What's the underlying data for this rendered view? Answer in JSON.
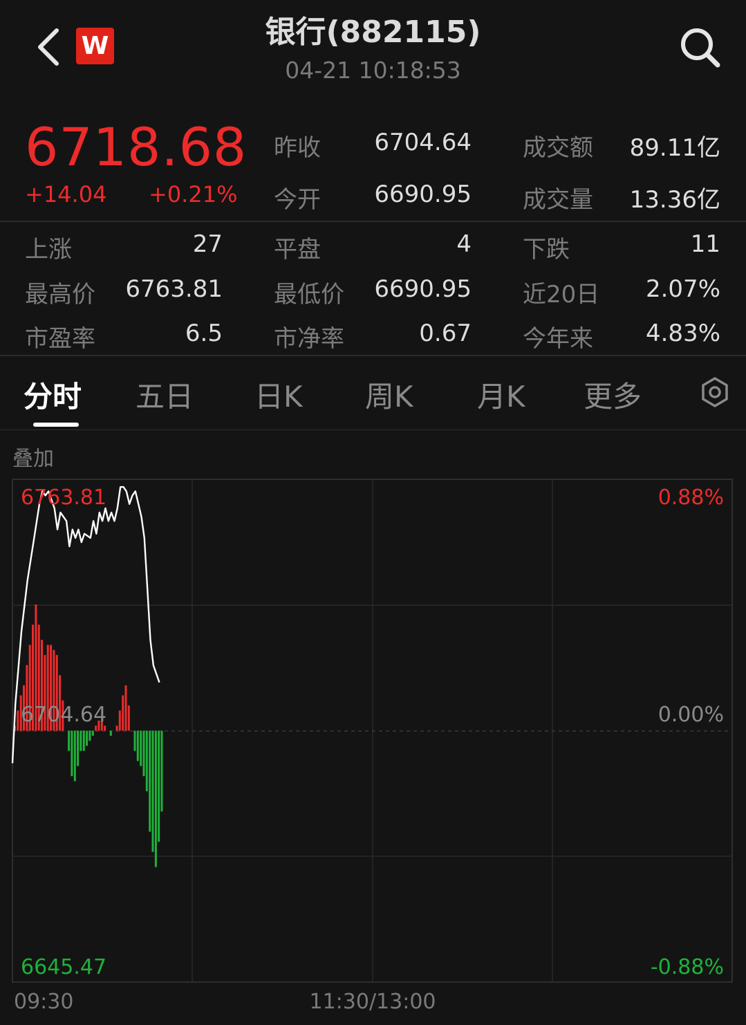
{
  "header": {
    "title": "银行(882115)",
    "timestamp": "04-21 10:18:53",
    "logo_text": "W",
    "icons": {
      "back": "chevron-left-icon",
      "search": "search-icon",
      "settings": "gear-icon"
    }
  },
  "quote": {
    "price": "6718.68",
    "change": "+14.04",
    "change_pct": "+0.21%",
    "stats": [
      {
        "label": "昨收",
        "value": "6704.64"
      },
      {
        "label": "成交额",
        "value": "89.11亿"
      },
      {
        "label": "今开",
        "value": "6690.95"
      },
      {
        "label": "成交量",
        "value": "13.36亿"
      }
    ]
  },
  "details": [
    {
      "label": "上涨",
      "value": "27"
    },
    {
      "label": "平盘",
      "value": "4"
    },
    {
      "label": "下跌",
      "value": "11"
    },
    {
      "label": "最高价",
      "value": "6763.81"
    },
    {
      "label": "最低价",
      "value": "6690.95"
    },
    {
      "label": "近20日",
      "value": "2.07%"
    },
    {
      "label": "市盈率",
      "value": "6.5"
    },
    {
      "label": "市净率",
      "value": "0.67"
    },
    {
      "label": "今年来",
      "value": "4.83%"
    }
  ],
  "tabs": [
    {
      "label": "分时",
      "active": true
    },
    {
      "label": "五日"
    },
    {
      "label": "日K"
    },
    {
      "label": "周K"
    },
    {
      "label": "月K"
    },
    {
      "label": "更多"
    }
  ],
  "overlay_label": "叠加",
  "colors": {
    "up": "#ee2b2b",
    "down": "#1fb23a",
    "line": "#ffffff",
    "background": "#141414"
  },
  "chart_data": {
    "type": "line",
    "y_labels": {
      "top": "6763.81",
      "mid": "6704.64",
      "bottom": "6645.47"
    },
    "pct_labels": {
      "top": "0.88%",
      "mid": "0.00%",
      "bottom": "-0.88%"
    },
    "x_labels": {
      "start": "09:30",
      "mid": "11:30/13:00"
    },
    "ylim": [
      6645.47,
      6763.81
    ],
    "baseline": 6704.64,
    "total_minutes": 240,
    "price_series": [
      [
        0,
        6697
      ],
      [
        1,
        6711
      ],
      [
        3,
        6728
      ],
      [
        5,
        6740
      ],
      [
        7,
        6749
      ],
      [
        9,
        6758
      ],
      [
        10,
        6761
      ],
      [
        11,
        6760
      ],
      [
        12,
        6761
      ],
      [
        14,
        6757
      ],
      [
        15,
        6752
      ],
      [
        16,
        6756
      ],
      [
        18,
        6754
      ],
      [
        19,
        6748
      ],
      [
        20,
        6752
      ],
      [
        21,
        6750
      ],
      [
        22,
        6752
      ],
      [
        23,
        6749
      ],
      [
        24,
        6751
      ],
      [
        26,
        6750
      ],
      [
        27,
        6754
      ],
      [
        28,
        6751
      ],
      [
        29,
        6756
      ],
      [
        30,
        6754
      ],
      [
        31,
        6757
      ],
      [
        32,
        6754
      ],
      [
        33,
        6756
      ],
      [
        34,
        6754
      ],
      [
        35,
        6757
      ],
      [
        36,
        6762
      ],
      [
        37,
        6762
      ],
      [
        38,
        6761
      ],
      [
        39,
        6758
      ],
      [
        40,
        6760
      ],
      [
        41,
        6761
      ],
      [
        42,
        6758
      ],
      [
        43,
        6755
      ],
      [
        44,
        6750
      ],
      [
        45,
        6738
      ],
      [
        46,
        6726
      ],
      [
        47,
        6720
      ],
      [
        49,
        6716
      ]
    ],
    "bars": [
      [
        0,
        1
      ],
      [
        1,
        4
      ],
      [
        2,
        7
      ],
      [
        3,
        9
      ],
      [
        4,
        13
      ],
      [
        5,
        17
      ],
      [
        6,
        21
      ],
      [
        7,
        25
      ],
      [
        8,
        21
      ],
      [
        9,
        18
      ],
      [
        10,
        15
      ],
      [
        11,
        17
      ],
      [
        12,
        17
      ],
      [
        13,
        16
      ],
      [
        14,
        15
      ],
      [
        15,
        11
      ],
      [
        16,
        6
      ],
      [
        17,
        0
      ],
      [
        18,
        -4
      ],
      [
        19,
        -9
      ],
      [
        20,
        -10
      ],
      [
        21,
        -7
      ],
      [
        22,
        -4
      ],
      [
        23,
        -4
      ],
      [
        24,
        -3
      ],
      [
        25,
        -2
      ],
      [
        26,
        -1
      ],
      [
        27,
        1
      ],
      [
        28,
        2
      ],
      [
        29,
        2
      ],
      [
        30,
        1
      ],
      [
        31,
        0
      ],
      [
        32,
        -1
      ],
      [
        33,
        0
      ],
      [
        34,
        1
      ],
      [
        35,
        4
      ],
      [
        36,
        7
      ],
      [
        37,
        9
      ],
      [
        38,
        5
      ],
      [
        39,
        0
      ],
      [
        40,
        -4
      ],
      [
        41,
        -6
      ],
      [
        42,
        -7
      ],
      [
        43,
        -9
      ],
      [
        44,
        -12
      ],
      [
        45,
        -20
      ],
      [
        46,
        -24
      ],
      [
        47,
        -27
      ],
      [
        48,
        -22
      ],
      [
        49,
        -16
      ]
    ]
  }
}
